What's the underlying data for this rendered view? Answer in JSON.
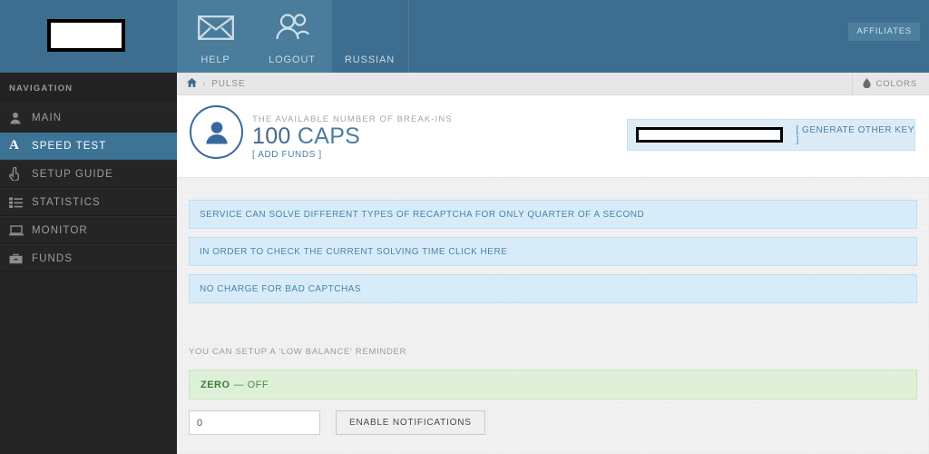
{
  "header": {
    "logo": {
      "name": "site-logo",
      "redacted": true
    },
    "items": [
      {
        "label": "HELP",
        "icon": "envelope-icon",
        "highlighted": true
      },
      {
        "label": "LOGOUT",
        "icon": "users-icon",
        "highlighted": true
      },
      {
        "label": "RUSSIAN",
        "icon": "none",
        "highlighted": false
      }
    ],
    "affiliates_label": "AFFILIATES",
    "colors": {
      "base": "#3d6e8f",
      "panel": "#4a7c9b",
      "affiliates_bg": "#4c7f9e"
    }
  },
  "sidebar": {
    "title": "NAVIGATION",
    "items": [
      {
        "label": "MAIN",
        "icon": "user-icon",
        "active": false
      },
      {
        "label": "SPEED TEST",
        "icon": "letter-a-icon",
        "active": true
      },
      {
        "label": "SETUP GUIDE",
        "icon": "hand-pointer-icon",
        "active": false
      },
      {
        "label": "STATISTICS",
        "icon": "list-icon",
        "active": false
      },
      {
        "label": "MONITOR",
        "icon": "laptop-icon",
        "active": false
      },
      {
        "label": "FUNDS",
        "icon": "briefcase-icon",
        "active": false
      }
    ],
    "active_color": "#3d7496"
  },
  "breadcrumb": {
    "home_icon": "home-icon",
    "separator": "›",
    "current": "PULSE",
    "colors_button": {
      "label": "COLORS",
      "icon": "droplet-icon"
    }
  },
  "hero": {
    "avatar_icon": "user-avatar-icon",
    "label": "THE AVAILABLE NUMBER OF BREAK-INS",
    "amount": "100",
    "unit": "CAPS",
    "add_funds_link": "[ ADD FUNDS ]",
    "api_key": {
      "value": "",
      "redacted": true,
      "generate_link": "[ GENERATE OTHER KEY ]"
    }
  },
  "alerts": [
    {
      "text": "SERVICE CAN SOLVE DIFFERENT TYPES OF RECAPTCHA FOR ONLY QUARTER OF A SECOND"
    },
    {
      "text": "IN ORDER TO CHECK THE CURRENT SOLVING TIME CLICK HERE"
    },
    {
      "text": "NO CHARGE FOR BAD CAPTCHAS"
    }
  ],
  "reminder": {
    "label": "YOU CAN SETUP A 'LOW BALANCE' REMINDER",
    "status_bold": "ZERO",
    "status_rest": "— OFF",
    "threshold_value": "0",
    "threshold_placeholder": "0",
    "button_label": "ENABLE NOTIFICATIONS"
  }
}
